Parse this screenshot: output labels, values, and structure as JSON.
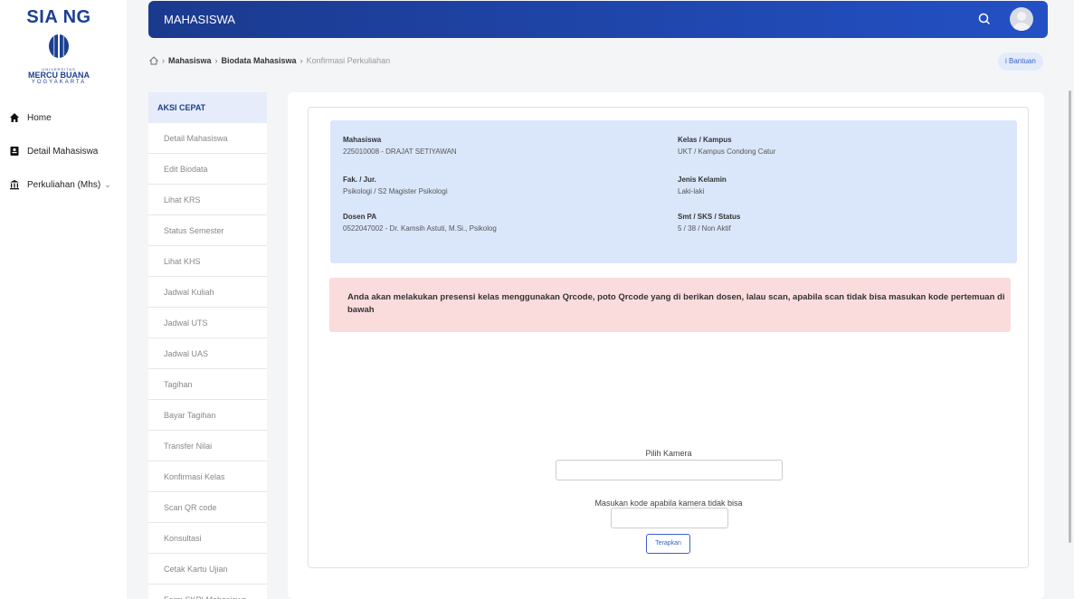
{
  "brand": {
    "title": "SIA NG",
    "logo_univ": "UNIVERSITAS",
    "logo_name": "MERCU BUANA",
    "logo_city": "YOGYAKARTA"
  },
  "nav": {
    "items": [
      {
        "label": "Home",
        "icon": "home-icon"
      },
      {
        "label": "Detail Mahasiswa",
        "icon": "id-card-icon"
      },
      {
        "label": "Perkuliahan (Mhs)",
        "icon": "building-icon"
      }
    ]
  },
  "topbar": {
    "title": "MAHASISWA"
  },
  "breadcrumb": {
    "items": [
      "Mahasiswa",
      "Biodata Mahasiswa",
      "Konfirmasi Perkuliahan"
    ],
    "help_label": "Bantuan"
  },
  "quick_actions": {
    "title": "AKSI CEPAT",
    "items": [
      "Detail Mahasiswa",
      "Edit Biodata",
      "Lihat KRS",
      "Status Semester",
      "Lihat KHS",
      "Jadwal Kuliah",
      "Jadwal UTS",
      "Jadwal UAS",
      "Tagihan",
      "Bayar Tagihan",
      "Transfer Nilai",
      "Konfirmasi Kelas",
      "Scan QR code",
      "Konsultasi",
      "Cetak Kartu Ujian",
      "Form SKPI Mahasiswa"
    ]
  },
  "student_info": {
    "mahasiswa_label": "Mahasiswa",
    "mahasiswa_value": "225010008 - DRAJAT SETIYAWAN",
    "fakjur_label": "Fak. / Jur.",
    "fakjur_value": "Psikologi / S2 Magister Psikologi",
    "dosen_label": "Dosen PA",
    "dosen_value": "0522047002 - Dr. Kamsih Astuti, M.Si., Psikolog",
    "kelas_label": "Kelas / Kampus",
    "kelas_value": "UKT / Kampus Condong Catur",
    "jk_label": "Jenis Kelamin",
    "jk_value": "Laki-laki",
    "smt_label": "Smt / SKS / Status",
    "smt_value": "5 / 38 / Non Aktif"
  },
  "alert": {
    "text": "Anda akan melakukan presensi kelas menggunakan Qrcode, poto Qrcode yang di berikan dosen, lalau scan, apabila scan tidak bisa masukan kode pertemuan di bawah"
  },
  "form": {
    "camera_label": "Pilih Kamera",
    "camera_value": "",
    "code_label": "Masukan kode apabila kamera tidak bisa",
    "code_value": "",
    "apply_label": "Terapkan"
  },
  "colors": {
    "primary": "#1c3f91",
    "topbar_start": "#1b3a8e",
    "topbar_end": "#2350c4",
    "info_bg": "#dae7fb",
    "alert_bg": "#fbdcdd"
  }
}
